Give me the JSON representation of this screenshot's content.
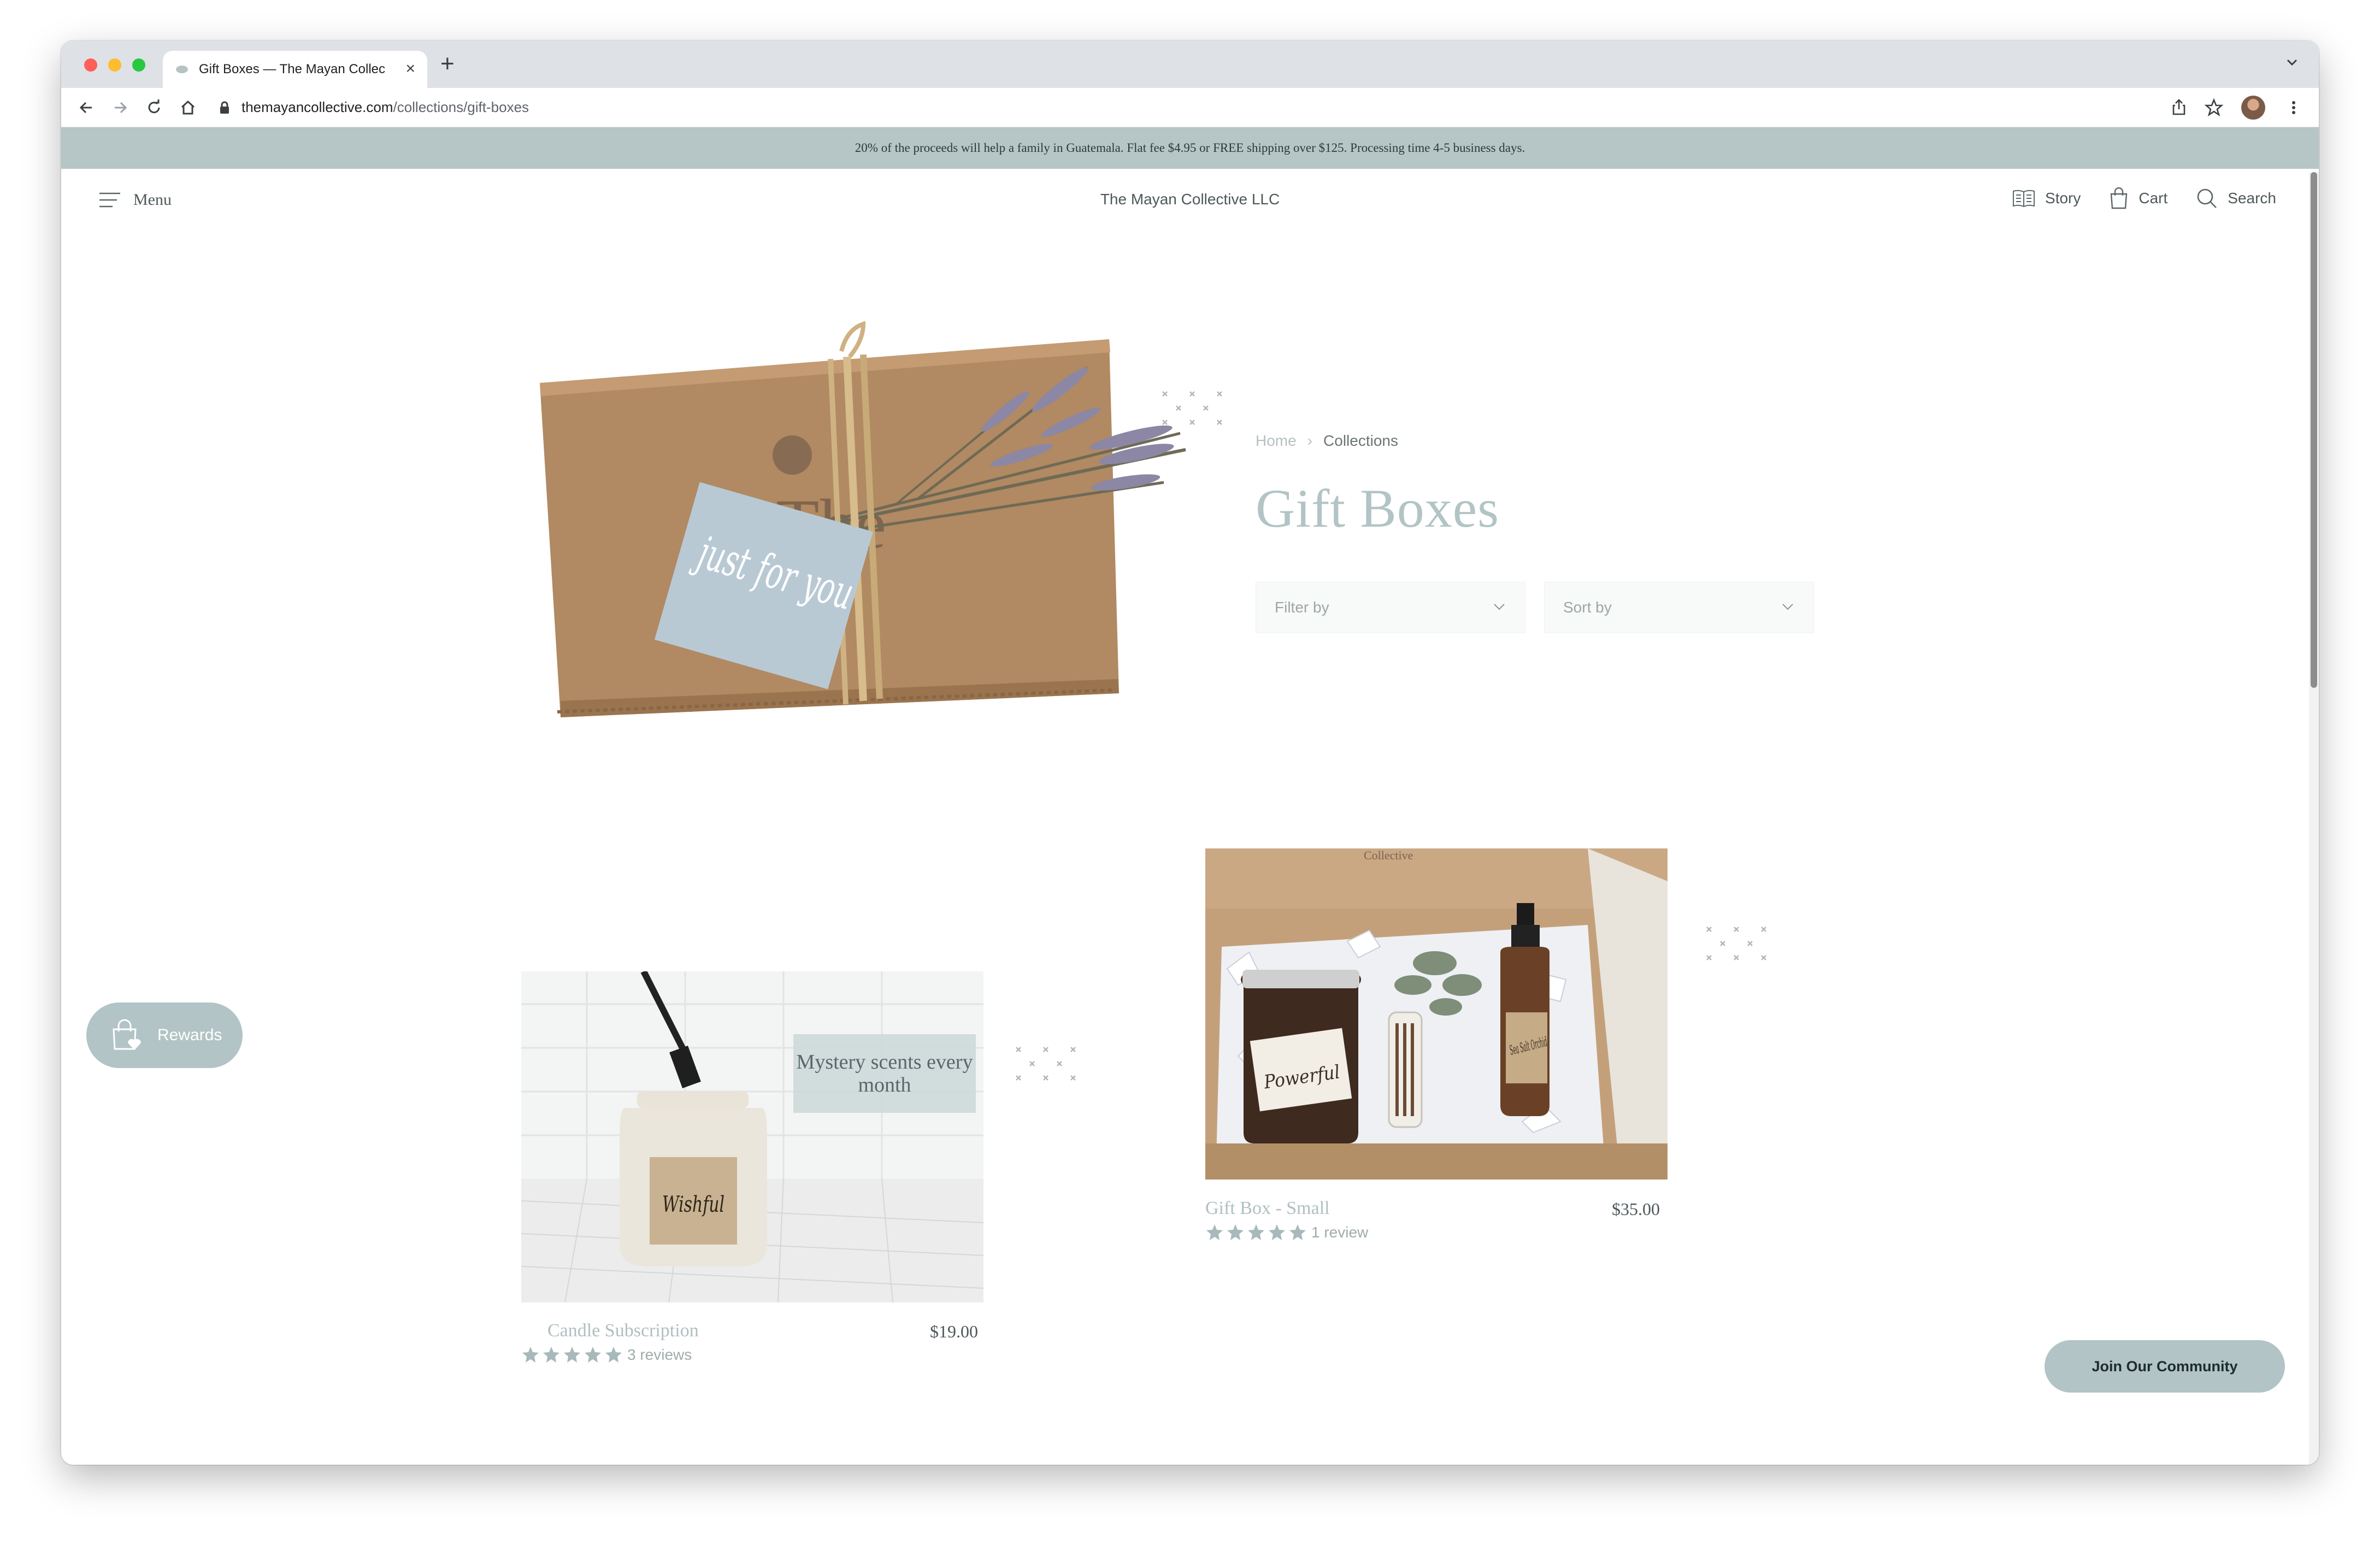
{
  "browser": {
    "tab_title": "Gift Boxes — The Mayan Collec",
    "url_host": "themayancollective.com",
    "url_path": "/collections/gift-boxes"
  },
  "announcement": "20% of the proceeds will help a family in Guatemala. Flat fee $4.95 or FREE shipping over $125. Processing time 4-5 business days.",
  "header": {
    "menu_label": "Menu",
    "store_name": "The Mayan Collective LLC",
    "story_label": "Story",
    "cart_label": "Cart",
    "search_label": "Search"
  },
  "breadcrumb": {
    "home": "Home",
    "current": "Collections"
  },
  "page_title": "Gift Boxes",
  "filters": {
    "filter_label": "Filter by",
    "sort_label": "Sort by"
  },
  "hero": {
    "card_text": "just for you",
    "box_logo_text": "The"
  },
  "products": [
    {
      "name": "Candle Subscription",
      "price": "$19.00",
      "rating": 5,
      "reviews": "3 reviews",
      "overlay_text": "Mystery scents every month",
      "label_text": "Wishful"
    },
    {
      "name": "Gift Box - Small",
      "price": "$35.00",
      "rating": 5,
      "reviews": "1 review",
      "label_text": "Powerful",
      "bottle_text": "Sea Salt Orchid",
      "box_text": "Collective"
    }
  ],
  "rewards_label": "Rewards",
  "join_label": "Join Our Community",
  "colors": {
    "accent": "#b2c4c5",
    "announcement_bg": "#b6c5c6",
    "text": "#4d5859"
  }
}
